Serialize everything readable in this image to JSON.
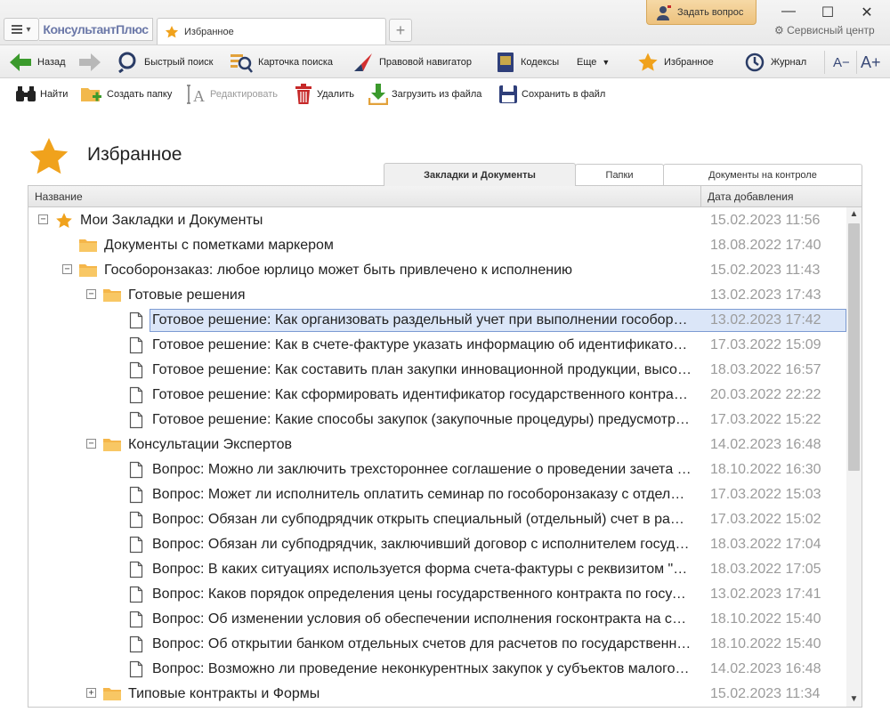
{
  "app": {
    "logo_text": "КонсультантПлюс",
    "tab_title": "Избранное",
    "ask_label": "Задать вопрос",
    "service_label": "Сервисный центр"
  },
  "toolbar": {
    "back": "Назад",
    "quick_search": "Быстрый поиск",
    "search_card": "Карточка поиска",
    "legal_navigator": "Правовой навигатор",
    "codes": "Кодексы",
    "more": "Еще",
    "favorites": "Избранное",
    "journal": "Журнал",
    "font_decrease": "A−",
    "font_increase": "A+"
  },
  "actions": {
    "find": "Найти",
    "create_folder": "Создать папку",
    "edit": "Редактировать",
    "delete": "Удалить",
    "load_from_file": "Загрузить из файла",
    "save_to_file": "Сохранить в файл"
  },
  "page": {
    "title": "Избранное",
    "tabs": [
      "Закладки и Документы",
      "Папки",
      "Документы на контроле"
    ],
    "columns": {
      "name": "Название",
      "date_added": "Дата добавления"
    }
  },
  "tree": [
    {
      "level": 0,
      "type": "root",
      "expander": "−",
      "title": "Мои Закладки и Документы",
      "date": "15.02.2023 11:56"
    },
    {
      "level": 1,
      "type": "folder",
      "expander": "",
      "title": "Документы с пометками маркером",
      "date": "18.08.2022 17:40"
    },
    {
      "level": 1,
      "type": "folder",
      "expander": "−",
      "title": "Гособоронзаказ: любое юрлицо может быть привлечено к исполнению",
      "date": "15.02.2023 11:43"
    },
    {
      "level": 2,
      "type": "folder",
      "expander": "−",
      "title": "Готовые решения",
      "date": "13.02.2023 17:43"
    },
    {
      "level": 3,
      "type": "doc",
      "expander": "",
      "title": "Готовое решение: Как организовать раздельный учет при выполнении гособоро...",
      "date": "13.02.2023 17:42",
      "selected": true
    },
    {
      "level": 3,
      "type": "doc",
      "expander": "",
      "title": "Готовое решение: Как в счете-фактуре указать информацию об идентификаторе...",
      "date": "17.03.2022 15:09"
    },
    {
      "level": 3,
      "type": "doc",
      "expander": "",
      "title": "Готовое решение: Как составить план закупки инновационной продукции, высок...",
      "date": "18.03.2022 16:57"
    },
    {
      "level": 3,
      "type": "doc",
      "expander": "",
      "title": "Готовое решение: Как сформировать идентификатор государственного контрак...",
      "date": "20.03.2022 22:22"
    },
    {
      "level": 3,
      "type": "doc",
      "expander": "",
      "title": "Готовое решение: Какие способы закупок (закупочные процедуры) предусмотре...",
      "date": "17.03.2022 15:22"
    },
    {
      "level": 2,
      "type": "folder",
      "expander": "−",
      "title": "Консультации Экспертов",
      "date": "14.02.2023 16:48"
    },
    {
      "level": 3,
      "type": "doc",
      "expander": "",
      "title": "Вопрос: Можно ли заключить трехстороннее соглашение о проведении зачета в...",
      "date": "18.10.2022 16:30"
    },
    {
      "level": 3,
      "type": "doc",
      "expander": "",
      "title": "Вопрос: Может ли исполнитель оплатить семинар по гособоронзаказу с отдельн...",
      "date": "17.03.2022 15:03"
    },
    {
      "level": 3,
      "type": "doc",
      "expander": "",
      "title": "Вопрос: Обязан ли субподрядчик открыть специальный (отдельный) счет в рамк...",
      "date": "17.03.2022 15:02"
    },
    {
      "level": 3,
      "type": "doc",
      "expander": "",
      "title": "Вопрос: Обязан ли субподрядчик, заключивший договор с исполнителем госуда...",
      "date": "18.03.2022 17:04"
    },
    {
      "level": 3,
      "type": "doc",
      "expander": "",
      "title": "Вопрос: В каких ситуациях используется форма счета-фактуры с реквизитом \"Ид...",
      "date": "18.03.2022 17:05"
    },
    {
      "level": 3,
      "type": "doc",
      "expander": "",
      "title": "Вопрос: Каков порядок определения цены государственного контракта по госуд...",
      "date": "13.02.2023 17:41"
    },
    {
      "level": 3,
      "type": "doc",
      "expander": "",
      "title": "Вопрос: Об изменении условия об обеспечении исполнения госконтракта на соз...",
      "date": "18.10.2022 15:40"
    },
    {
      "level": 3,
      "type": "doc",
      "expander": "",
      "title": "Вопрос: Об открытии банком отдельных счетов для расчетов по государственно...",
      "date": "18.10.2022 15:40"
    },
    {
      "level": 3,
      "type": "doc",
      "expander": "",
      "title": "Вопрос: Возможно ли проведение неконкурентных закупок у субъектов малого п...",
      "date": "14.02.2023 16:48"
    },
    {
      "level": 2,
      "type": "folder",
      "expander": "+",
      "title": "Типовые контракты и Формы",
      "date": "15.02.2023 11:34"
    }
  ]
}
